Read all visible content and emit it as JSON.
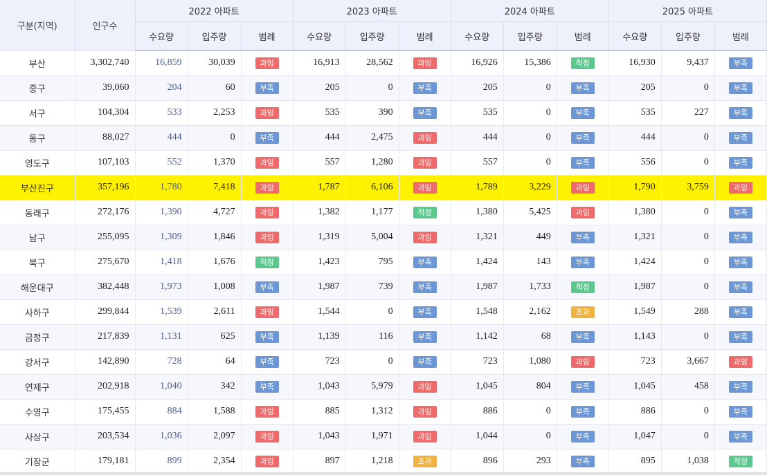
{
  "header": {
    "region": "구분(지역)",
    "population": "인구수",
    "years": [
      "2022 아파트",
      "2023 아파트",
      "2024 아파트",
      "2025 아파트"
    ],
    "sub": {
      "demand": "수요량",
      "supply": "입주량",
      "legend": "범례"
    }
  },
  "colors": {
    "over": "#ef6a6a",
    "short": "#6c96d4",
    "ok": "#5dc88e",
    "excess": "#f0b240",
    "highlight": "#fff200",
    "header_bg": "#eef1fb"
  },
  "legend_labels": {
    "over": "과잉",
    "short": "부족",
    "ok": "적정",
    "excess": "초과"
  },
  "rows": [
    {
      "region": "부산",
      "pop": "3,302,740",
      "y": [
        [
          "16,859",
          "30,039",
          "과잉",
          "over"
        ],
        [
          "16,913",
          "28,562",
          "과잉",
          "over"
        ],
        [
          "16,926",
          "15,386",
          "적정",
          "ok"
        ],
        [
          "16,930",
          "9,437",
          "부족",
          "short"
        ]
      ]
    },
    {
      "region": "중구",
      "pop": "39,060",
      "y": [
        [
          "204",
          "60",
          "부족",
          "short"
        ],
        [
          "205",
          "0",
          "부족",
          "short"
        ],
        [
          "205",
          "0",
          "부족",
          "short"
        ],
        [
          "205",
          "0",
          "부족",
          "short"
        ]
      ]
    },
    {
      "region": "서구",
      "pop": "104,304",
      "y": [
        [
          "533",
          "2,253",
          "과잉",
          "over"
        ],
        [
          "535",
          "390",
          "부족",
          "short"
        ],
        [
          "535",
          "0",
          "부족",
          "short"
        ],
        [
          "535",
          "227",
          "부족",
          "short"
        ]
      ]
    },
    {
      "region": "동구",
      "pop": "88,027",
      "y": [
        [
          "444",
          "0",
          "부족",
          "short"
        ],
        [
          "444",
          "2,475",
          "과잉",
          "over"
        ],
        [
          "444",
          "0",
          "부족",
          "short"
        ],
        [
          "444",
          "0",
          "부족",
          "short"
        ]
      ]
    },
    {
      "region": "영도구",
      "pop": "107,103",
      "y": [
        [
          "552",
          "1,370",
          "과잉",
          "over"
        ],
        [
          "557",
          "1,280",
          "과잉",
          "over"
        ],
        [
          "557",
          "0",
          "부족",
          "short"
        ],
        [
          "556",
          "0",
          "부족",
          "short"
        ]
      ]
    },
    {
      "region": "부산진구",
      "pop": "357,196",
      "highlight": true,
      "y": [
        [
          "1,780",
          "7,418",
          "과잉",
          "over"
        ],
        [
          "1,787",
          "6,106",
          "과잉",
          "over"
        ],
        [
          "1,789",
          "3,229",
          "과잉",
          "over"
        ],
        [
          "1,790",
          "3,759",
          "과잉",
          "over"
        ]
      ]
    },
    {
      "region": "동래구",
      "pop": "272,176",
      "y": [
        [
          "1,390",
          "4,727",
          "과잉",
          "over"
        ],
        [
          "1,382",
          "1,177",
          "적정",
          "ok"
        ],
        [
          "1,380",
          "5,425",
          "과잉",
          "over"
        ],
        [
          "1,380",
          "0",
          "부족",
          "short"
        ]
      ]
    },
    {
      "region": "남구",
      "pop": "255,095",
      "y": [
        [
          "1,309",
          "1,846",
          "과잉",
          "over"
        ],
        [
          "1,319",
          "5,004",
          "과잉",
          "over"
        ],
        [
          "1,321",
          "449",
          "부족",
          "short"
        ],
        [
          "1,321",
          "0",
          "부족",
          "short"
        ]
      ]
    },
    {
      "region": "북구",
      "pop": "275,670",
      "y": [
        [
          "1,418",
          "1,676",
          "적정",
          "ok"
        ],
        [
          "1,423",
          "795",
          "부족",
          "short"
        ],
        [
          "1,424",
          "143",
          "부족",
          "short"
        ],
        [
          "1,424",
          "0",
          "부족",
          "short"
        ]
      ]
    },
    {
      "region": "해운대구",
      "pop": "382,448",
      "y": [
        [
          "1,973",
          "1,008",
          "부족",
          "short"
        ],
        [
          "1,987",
          "739",
          "부족",
          "short"
        ],
        [
          "1,987",
          "1,733",
          "적정",
          "ok"
        ],
        [
          "1,987",
          "0",
          "부족",
          "short"
        ]
      ]
    },
    {
      "region": "사하구",
      "pop": "299,844",
      "y": [
        [
          "1,539",
          "2,611",
          "과잉",
          "over"
        ],
        [
          "1,544",
          "0",
          "부족",
          "short"
        ],
        [
          "1,548",
          "2,162",
          "초과",
          "excess"
        ],
        [
          "1,549",
          "288",
          "부족",
          "short"
        ]
      ]
    },
    {
      "region": "금정구",
      "pop": "217,839",
      "y": [
        [
          "1,131",
          "625",
          "부족",
          "short"
        ],
        [
          "1,139",
          "116",
          "부족",
          "short"
        ],
        [
          "1,142",
          "68",
          "부족",
          "short"
        ],
        [
          "1,143",
          "0",
          "부족",
          "short"
        ]
      ]
    },
    {
      "region": "강서구",
      "pop": "142,890",
      "y": [
        [
          "728",
          "64",
          "부족",
          "short"
        ],
        [
          "723",
          "0",
          "부족",
          "short"
        ],
        [
          "723",
          "1,080",
          "과잉",
          "over"
        ],
        [
          "723",
          "3,667",
          "과잉",
          "over"
        ]
      ]
    },
    {
      "region": "연제구",
      "pop": "202,918",
      "y": [
        [
          "1,040",
          "342",
          "부족",
          "short"
        ],
        [
          "1,043",
          "5,979",
          "과잉",
          "over"
        ],
        [
          "1,045",
          "804",
          "부족",
          "short"
        ],
        [
          "1,045",
          "458",
          "부족",
          "short"
        ]
      ]
    },
    {
      "region": "수영구",
      "pop": "175,455",
      "y": [
        [
          "884",
          "1,588",
          "과잉",
          "over"
        ],
        [
          "885",
          "1,312",
          "과잉",
          "over"
        ],
        [
          "886",
          "0",
          "부족",
          "short"
        ],
        [
          "886",
          "0",
          "부족",
          "short"
        ]
      ]
    },
    {
      "region": "사상구",
      "pop": "203,534",
      "y": [
        [
          "1,036",
          "2,097",
          "과잉",
          "over"
        ],
        [
          "1,043",
          "1,971",
          "과잉",
          "over"
        ],
        [
          "1,044",
          "0",
          "부족",
          "short"
        ],
        [
          "1,047",
          "0",
          "부족",
          "short"
        ]
      ]
    },
    {
      "region": "기장군",
      "pop": "179,181",
      "y": [
        [
          "899",
          "2,354",
          "과잉",
          "over"
        ],
        [
          "897",
          "1,218",
          "초과",
          "excess"
        ],
        [
          "896",
          "293",
          "부족",
          "short"
        ],
        [
          "895",
          "1,038",
          "적정",
          "ok"
        ]
      ]
    }
  ]
}
